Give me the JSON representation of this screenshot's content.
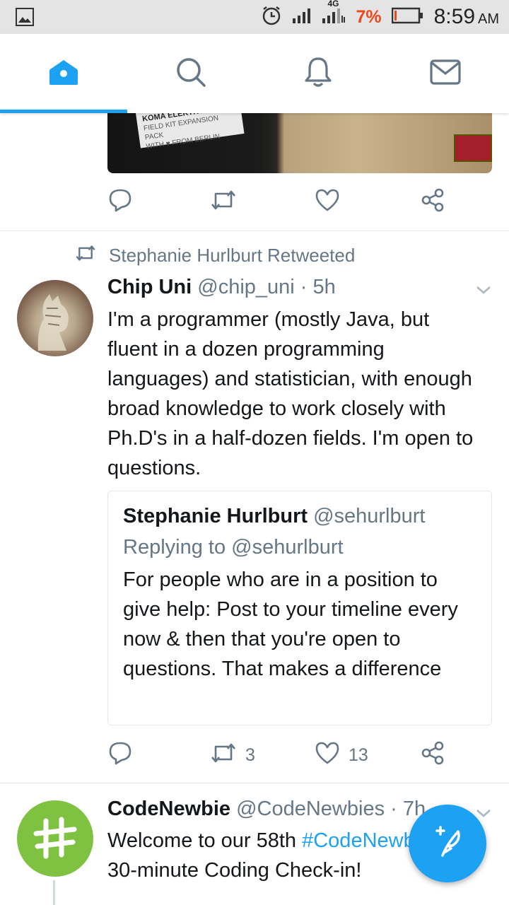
{
  "status_bar": {
    "network": "4G",
    "battery_percent": "7%",
    "time": "8:59",
    "time_suffix": "AM"
  },
  "tabs": [
    {
      "name": "home",
      "icon": "home-icon",
      "selected": true
    },
    {
      "name": "search",
      "icon": "search-icon",
      "selected": false
    },
    {
      "name": "notifications",
      "icon": "bell-icon",
      "selected": false
    },
    {
      "name": "messages",
      "icon": "mail-icon",
      "selected": false
    }
  ],
  "accent_color": "#1da1f2",
  "feed": {
    "media_tweet": {
      "image_text": {
        "brand": "KOMA ELEKTRONIK",
        "product": "FIELD KIT EXPANSION PACK",
        "tagline": "WITH ♥ FROM BERLIN"
      }
    },
    "retweet_tweet": {
      "retweet_label": "Stephanie Hurlburt Retweeted",
      "author_name": "Chip Uni",
      "handle": "@chip_uni",
      "time": "· 5h",
      "text": "I'm a programmer (mostly Java, but fluent in a dozen programming languages) and statistician, with enough broad knowledge to work closely with Ph.D's in a half-dozen fields. I'm open to questions.",
      "quote": {
        "author_name": "Stephanie Hurlburt",
        "handle": "@sehurlburt",
        "replying_to": "Replying to @sehurlburt",
        "text": "For people who are in a position to give help: Post to your timeline every now & then that you're open to questions. That makes a difference"
      },
      "retweet_count": "3",
      "like_count": "13"
    },
    "codenewbie_tweet": {
      "author_name": "CodeNewbie",
      "handle": "@CodeNewbies",
      "time": "· 7h",
      "text_before": "Welcome to our 58th ",
      "hashtag": "#CodeNewbie",
      "text_after": "30-minute Coding Check-in!"
    }
  }
}
